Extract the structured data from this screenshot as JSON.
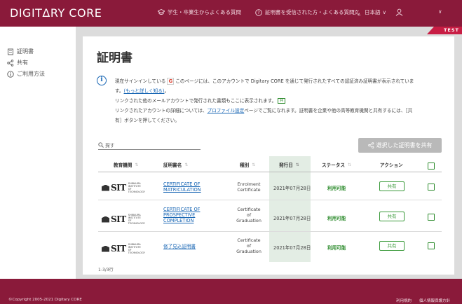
{
  "header": {
    "logo": "DIGITΔRY CORE",
    "nav_faq_students": "学生・卒業生からよくある質問",
    "nav_faq_recipients": "証明書を受信された方・よくある質問",
    "nav_language": "日本語",
    "nav_language_chevron": "∨",
    "nav_user_chevron": "∨"
  },
  "test_badge": "TEST",
  "sidebar": {
    "items": [
      {
        "label": "証明書"
      },
      {
        "label": "共有"
      },
      {
        "label": "ご利用方法"
      }
    ]
  },
  "page": {
    "title": "証明書",
    "info": {
      "line1_a": "現在サインインしている",
      "line1_b": "このページには、このアカウントで Digitary CORE を通じて発行されたすべての認証済み証明書が表示されていま",
      "line2_a": "す。",
      "line2_link": "(もっと詳しく知る)",
      "line2_b": "。",
      "line3": "リンクされた他のメールアカウントで発行された書類もここに表示されます。",
      "line4_a": "リンクされたアカウントの詳細については、",
      "line4_link": "プロファイル設定",
      "line4_b": "ページでご覧になれます。証明書を企業や他の高等教育機関と共有するには、［共",
      "line5": "有］ボタンを押してください。",
      "g_badge": "G",
      "mini_share": "共"
    },
    "search_placeholder": "探す",
    "share_selected": "選択した証明書を共有",
    "columns": {
      "institution": "教育機関",
      "cert_name": "証明書名",
      "type": "種別",
      "issued": "発行日",
      "status": "ステータス",
      "action": "アクション",
      "sort_glyph": "⇅",
      "sort_active_glyph": "⇅"
    },
    "rows": [
      {
        "inst_logo": "SIT",
        "inst_sub": "SHIBAURA INSTITUTE OF TECHNOLOGY",
        "cert": [
          "CERTIFICATE OF",
          "MATRICULATION"
        ],
        "type": [
          "Enrolment",
          "Certificate"
        ],
        "date": "2021年07月28日",
        "status": "利用可能",
        "action": "共有"
      },
      {
        "inst_logo": "SIT",
        "inst_sub": "SHIBAURA INSTITUTE OF TECHNOLOGY",
        "cert": [
          "CERTIFICATE OF",
          "PROSPECTIVE",
          "COMPLETION"
        ],
        "type": [
          "Certificate",
          "of",
          "Graduation"
        ],
        "date": "2021年07月28日",
        "status": "利用可能",
        "action": "共有"
      },
      {
        "inst_logo": "SIT",
        "inst_sub": "SHIBAURA INSTITUTE OF TECHNOLOGY",
        "cert": [
          "修了見込証明書"
        ],
        "type": [
          "Certificate",
          "of",
          "Graduation"
        ],
        "date": "2021年07月28日",
        "status": "利用可能",
        "action": "共有"
      }
    ],
    "count": "1-3/3行"
  },
  "footer": {
    "copyright": "©Copyright 2005-2021 Digitary CORE",
    "link1": "利用規約",
    "link2": "個人情報保護方針"
  },
  "colors": {
    "brand": "#8a1a3a",
    "accent": "#c81d44",
    "link": "#1866b4",
    "ok": "#2a8a2a",
    "date_column": "#e3ede4"
  }
}
